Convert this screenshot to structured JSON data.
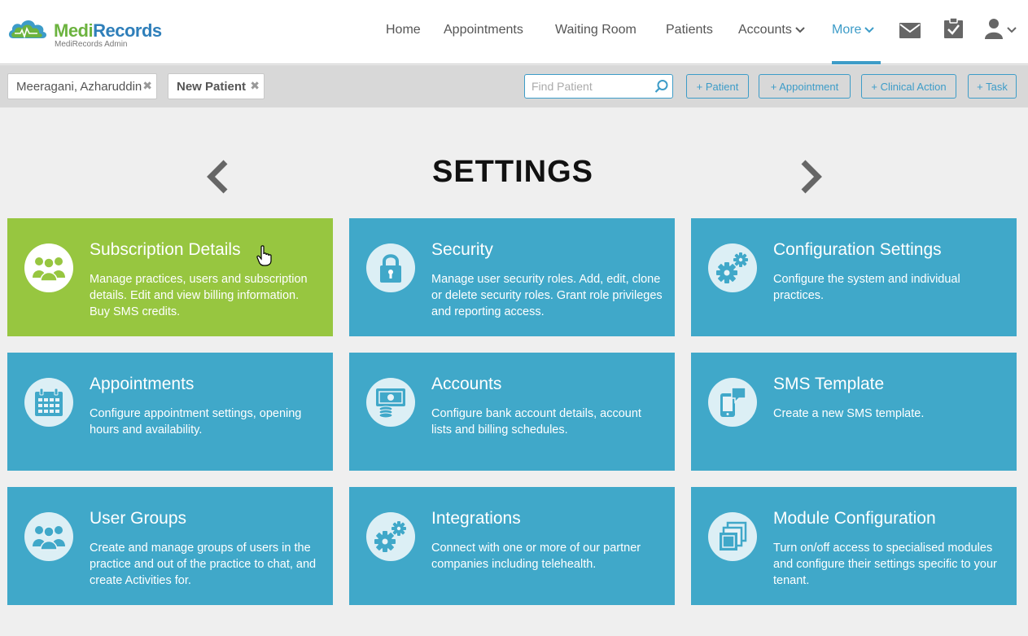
{
  "app": {
    "brand_part1": "Medi",
    "brand_part2": "Records",
    "subtitle": "MediRecords Admin"
  },
  "nav": {
    "home": "Home",
    "appointments": "Appointments",
    "waiting_room": "Waiting Room",
    "patients": "Patients",
    "accounts": "Accounts",
    "more": "More",
    "active": "More"
  },
  "header_icons": [
    "mail-icon",
    "clipboard-check-icon",
    "user-icon"
  ],
  "tabs": [
    {
      "label": "Meeragani, Azharuddin",
      "close": "✖"
    },
    {
      "label": "New Patient",
      "close": "✖"
    }
  ],
  "search": {
    "placeholder": "Find Patient",
    "value": ""
  },
  "quick_actions": {
    "patient": "+ Patient",
    "appointment": "+ Appointment",
    "clinical_action": "+ Clinical Action",
    "task": "+ Task"
  },
  "page": {
    "title": "SETTINGS"
  },
  "cards": [
    {
      "title": "Subscription Details",
      "desc": "Manage practices, users and subscription details. Edit and view billing information. Buy SMS credits.",
      "icon": "users-icon"
    },
    {
      "title": "Security",
      "desc": "Manage user security roles. Add, edit, clone or delete security roles. Grant role privileges and reporting access.",
      "icon": "lock-icon"
    },
    {
      "title": "Configuration Settings",
      "desc": "Configure the system and individual practices.",
      "icon": "gears-icon"
    },
    {
      "title": "Appointments",
      "desc": "Configure appointment settings, opening hours and availability.",
      "icon": "calendar-icon"
    },
    {
      "title": "Accounts",
      "desc": "Configure bank account details, account lists and billing schedules.",
      "icon": "money-icon"
    },
    {
      "title": "SMS Template",
      "desc": "Create a new SMS template.",
      "icon": "mobile-sms-icon"
    },
    {
      "title": "User Groups",
      "desc": "Create and manage groups of users in the practice and out of the practice to chat, and create Activities for.",
      "icon": "users-icon"
    },
    {
      "title": "Integrations",
      "desc": "Connect with one or more of our partner companies including telehealth.",
      "icon": "gears-icon"
    },
    {
      "title": "Module Configuration",
      "desc": "Turn on/off access to specialised modules and configure their settings specific to your tenant.",
      "icon": "modules-icon"
    }
  ],
  "colors": {
    "accent": "#3d9cc8",
    "card_blue": "#40a8c9",
    "card_green": "#97c640",
    "brand_green": "#6cb33f",
    "brand_blue": "#2f7fba"
  }
}
